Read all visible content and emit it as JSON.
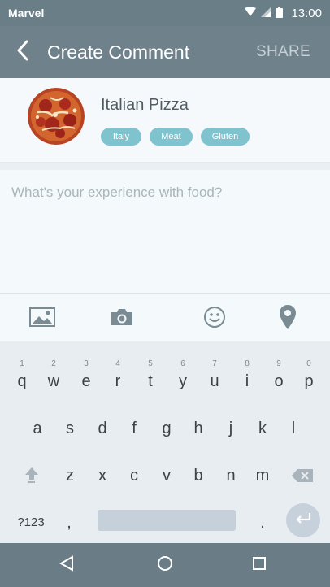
{
  "status_bar": {
    "carrier": "Marvel",
    "time": "13:00"
  },
  "app_bar": {
    "title": "Create Comment",
    "share_label": "SHARE"
  },
  "food": {
    "name": "Italian Pizza",
    "tags": [
      "Italy",
      "Meat",
      "Gluten"
    ]
  },
  "comment": {
    "placeholder": "What's your experience with food?"
  },
  "media_bar": {
    "icons": [
      "image-icon",
      "camera-icon",
      "emoji-icon",
      "location-pin-icon"
    ]
  },
  "keyboard": {
    "row1": [
      {
        "ch": "q",
        "hint": "1"
      },
      {
        "ch": "w",
        "hint": "2"
      },
      {
        "ch": "e",
        "hint": "3"
      },
      {
        "ch": "r",
        "hint": "4"
      },
      {
        "ch": "t",
        "hint": "5"
      },
      {
        "ch": "y",
        "hint": "6"
      },
      {
        "ch": "u",
        "hint": "7"
      },
      {
        "ch": "i",
        "hint": "8"
      },
      {
        "ch": "o",
        "hint": "9"
      },
      {
        "ch": "p",
        "hint": "0"
      }
    ],
    "row2": [
      "a",
      "s",
      "d",
      "f",
      "g",
      "h",
      "j",
      "k",
      "l"
    ],
    "row3": [
      "z",
      "x",
      "c",
      "v",
      "b",
      "n",
      "m"
    ],
    "symbols_label": "?123",
    "comma": ",",
    "period": "."
  },
  "colors": {
    "app_bar": "#6f828c",
    "status_bar": "#6a7e88",
    "tag": "#7ec3cd",
    "keyboard": "#e8edf1",
    "nav_bar": "#6a7c86"
  }
}
